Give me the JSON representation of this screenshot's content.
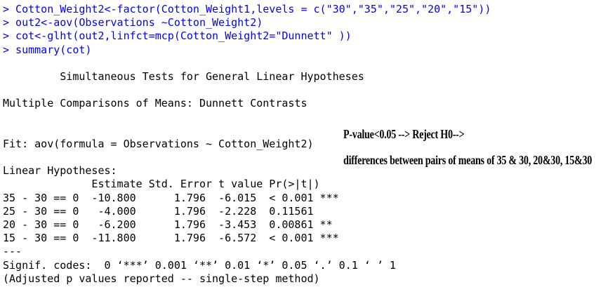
{
  "commands": [
    "> Cotton_Weight2<-factor(Cotton_Weight1,levels = c(\"30\",\"35\",\"25\",\"20\",\"15\"))",
    "> out2<-aov(Observations ~Cotton_Weight2)",
    "> cot<-glht(out2,linfct=mcp(Cotton_Weight2=\"Dunnett\" ))",
    "> summary(cot)"
  ],
  "output": {
    "title": "         Simultaneous Tests for General Linear Hypotheses",
    "comparisons": "Multiple Comparisons of Means: Dunnett Contrasts",
    "fit": "Fit: aov(formula = Observations ~ Cotton_Weight2)",
    "hypotheses_label": "Linear Hypotheses:",
    "table_header": "              Estimate Std. Error t value Pr(>|t|)    ",
    "rows": [
      "35 - 30 == 0  -10.800      1.796  -6.015  < 0.001 ***",
      "25 - 30 == 0   -4.000      1.796  -2.228  0.11561    ",
      "20 - 30 == 0   -6.200      1.796  -3.453  0.00861 ** ",
      "15 - 30 == 0  -11.800      1.796  -6.572  < 0.001 ***"
    ],
    "separator": "---",
    "signif": "Signif. codes:  0 ‘***’ 0.001 ‘**’ 0.01 ‘*’ 0.05 ‘.’ 0.1 ‘ ’ 1",
    "adjusted": "(Adjusted p values reported -- single-step method)"
  },
  "annotations": {
    "line1": "P-value<0.05 --> Reject H0-->",
    "line2": "differences between pairs of means of 35 & 30, 20&30, 15&30"
  },
  "colors": {
    "command": "#0000ff",
    "output": "#000000",
    "background": "#ffffff"
  }
}
